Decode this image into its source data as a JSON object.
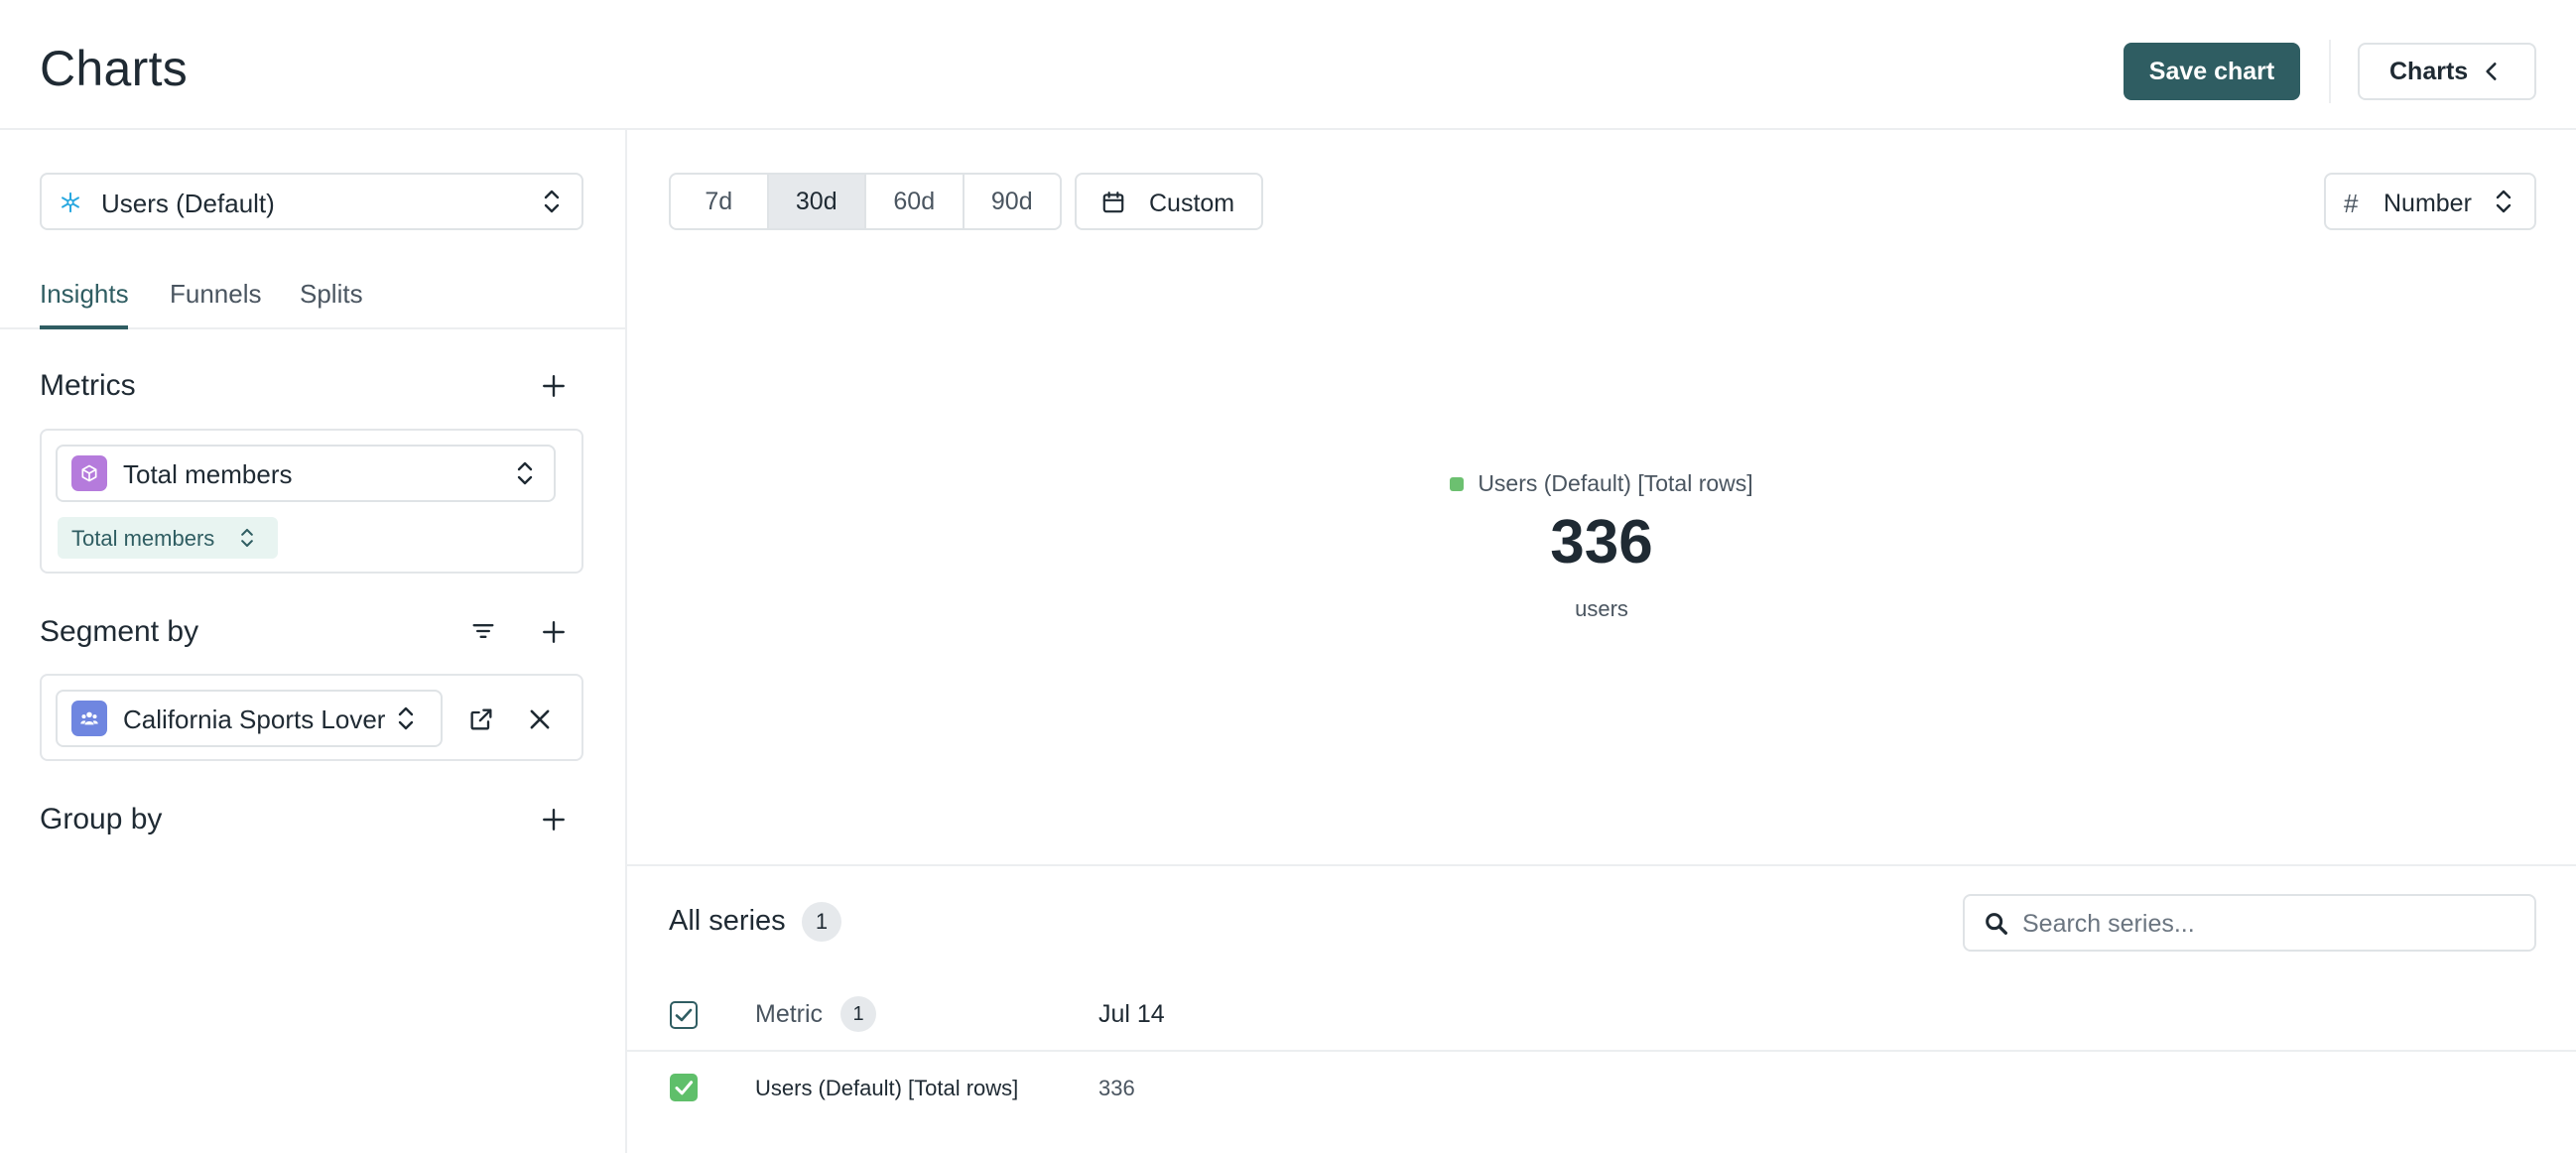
{
  "header": {
    "title": "Charts",
    "save_label": "Save chart",
    "charts_label": "Charts"
  },
  "sidebar": {
    "source": {
      "label": "Users (Default)",
      "icon": "snowflake-icon"
    },
    "tabs": [
      {
        "label": "Insights",
        "active": true
      },
      {
        "label": "Funnels",
        "active": false
      },
      {
        "label": "Splits",
        "active": false
      }
    ],
    "metrics": {
      "title": "Metrics",
      "select_label": "Total members",
      "chip_label": "Total members",
      "icon_color": "#b57bdc"
    },
    "segment_by": {
      "title": "Segment by",
      "select_label": "California Sports Lover",
      "icon_color": "#6f86e0"
    },
    "group_by": {
      "title": "Group by"
    }
  },
  "main": {
    "ranges": [
      {
        "label": "7d",
        "active": false
      },
      {
        "label": "30d",
        "active": true
      },
      {
        "label": "60d",
        "active": false
      },
      {
        "label": "90d",
        "active": false
      }
    ],
    "custom_label": "Custom",
    "view_label": "Number",
    "view_icon": "#"
  },
  "chart_data": {
    "type": "table",
    "series": [
      {
        "name": "Users (Default) [Total rows]",
        "values": [
          336
        ]
      }
    ],
    "big_value": "336",
    "unit": "users",
    "legend_color": "#6cc070"
  },
  "series_table": {
    "title": "All series",
    "count": "1",
    "search_placeholder": "Search series...",
    "metric_header": "Metric",
    "metric_count": "1",
    "date_header": "Jul 14",
    "rows": [
      {
        "metric": "Users (Default) [Total rows]",
        "value": "336",
        "checked": true
      }
    ]
  },
  "colors": {
    "accent": "#2f5d62",
    "success": "#5fbf6a"
  }
}
